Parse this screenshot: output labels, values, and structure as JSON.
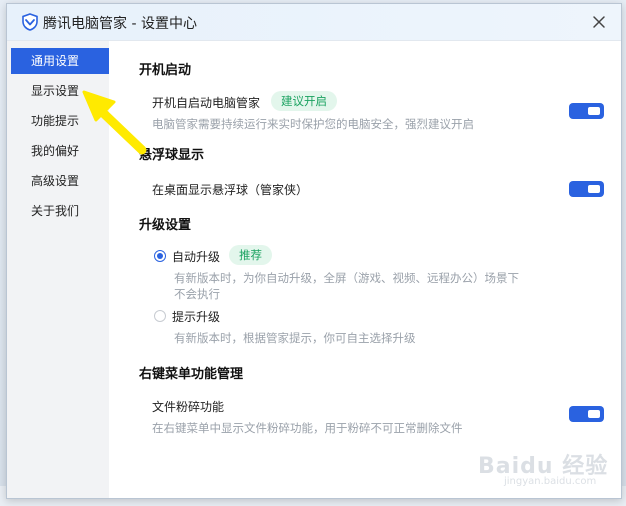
{
  "window": {
    "title": "腾讯电脑管家 - 设置中心"
  },
  "sidebar": {
    "items": [
      {
        "label": "通用设置",
        "active": true
      },
      {
        "label": "显示设置"
      },
      {
        "label": "功能提示"
      },
      {
        "label": "我的偏好"
      },
      {
        "label": "高级设置"
      },
      {
        "label": "关于我们"
      }
    ]
  },
  "sections": {
    "startup": {
      "title": "开机启动",
      "item_label": "开机自启动电脑管家",
      "badge": "建议开启",
      "desc": "电脑管家需要持续运行来实时保护您的电脑安全，强烈建议开启",
      "enabled": true
    },
    "floating": {
      "title": "悬浮球显示",
      "item_label": "在桌面显示悬浮球（管家侠）",
      "enabled": true
    },
    "upgrade": {
      "title": "升级设置",
      "auto_label": "自动升级",
      "auto_badge": "推荐",
      "auto_desc_line1": "有新版本时，为你自动升级，全屏（游戏、视频、远程办公）场景下",
      "auto_desc_line2": "不会执行",
      "prompt_label": "提示升级",
      "prompt_desc": "有新版本时，根据管家提示，你可自主选择升级",
      "selected": "auto"
    },
    "context_menu": {
      "title": "右键菜单功能管理",
      "item_label": "文件粉碎功能",
      "desc": "在右键菜单中显示文件粉碎功能，用于粉碎不可正常删除文件",
      "enabled": true
    }
  },
  "colors": {
    "accent": "#2a62e0",
    "badge_bg": "#e3f6ec",
    "badge_text": "#1aa260",
    "arrow": "#ffea00"
  },
  "icons": {
    "logo": "shield-icon",
    "close": "close-icon",
    "annotation": "arrow-pointer-icon"
  },
  "watermark": {
    "text": "Baidu 经验",
    "sub": "jingyan.baidu.com"
  }
}
